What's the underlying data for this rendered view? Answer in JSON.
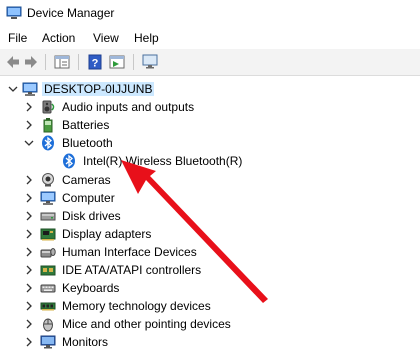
{
  "window": {
    "title": "Device Manager"
  },
  "menu": [
    "File",
    "Action",
    "View",
    "Help"
  ],
  "tree": {
    "root": "DESKTOP-0IJJUNB",
    "categories": [
      {
        "label": "Audio inputs and outputs",
        "icon": "speaker-icon",
        "expanded": false
      },
      {
        "label": "Batteries",
        "icon": "battery-icon",
        "expanded": false
      },
      {
        "label": "Bluetooth",
        "icon": "bluetooth-icon",
        "expanded": true,
        "children": [
          {
            "label": "Intel(R) Wireless Bluetooth(R)",
            "icon": "bluetooth-icon"
          }
        ]
      },
      {
        "label": "Cameras",
        "icon": "camera-icon",
        "expanded": false
      },
      {
        "label": "Computer",
        "icon": "computer-icon",
        "expanded": false
      },
      {
        "label": "Disk drives",
        "icon": "disk-icon",
        "expanded": false
      },
      {
        "label": "Display adapters",
        "icon": "display-adapter-icon",
        "expanded": false
      },
      {
        "label": "Human Interface Devices",
        "icon": "hid-icon",
        "expanded": false
      },
      {
        "label": "IDE ATA/ATAPI controllers",
        "icon": "ide-icon",
        "expanded": false
      },
      {
        "label": "Keyboards",
        "icon": "keyboard-icon",
        "expanded": false
      },
      {
        "label": "Memory technology devices",
        "icon": "memory-icon",
        "expanded": false
      },
      {
        "label": "Mice and other pointing devices",
        "icon": "mouse-icon",
        "expanded": false
      },
      {
        "label": "Monitors",
        "icon": "monitor-icon",
        "expanded": false
      }
    ]
  },
  "colors": {
    "selection": "#cce8ff",
    "arrow": "#e8101a",
    "bluetooth": "#1e6fd9"
  }
}
